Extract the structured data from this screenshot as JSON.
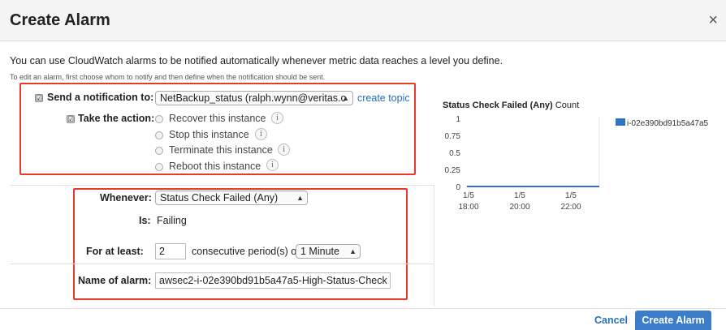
{
  "dialog": {
    "title": "Create Alarm",
    "close": "×",
    "intro": "You can use CloudWatch alarms to be notified automatically whenever metric data reaches a level you define.",
    "hint": "To edit an alarm, first choose whom to notify and then define when the notification should be sent."
  },
  "notify": {
    "checkbox": "☑",
    "label": "Send a notification to:",
    "topic": "NetBackup_status (ralph.wynn@veritas.c",
    "create_topic": "create topic"
  },
  "action": {
    "checkbox": "☑",
    "label": "Take the action:",
    "options": [
      {
        "label": "Recover this instance"
      },
      {
        "label": "Stop this instance"
      },
      {
        "label": "Terminate this instance"
      },
      {
        "label": "Reboot this instance"
      }
    ]
  },
  "condition": {
    "whenever_label": "Whenever:",
    "whenever_value": "Status Check Failed (Any)",
    "is_label": "Is:",
    "is_value": "Failing",
    "for_label": "For at least:",
    "periods": "2",
    "periods_text": "consecutive period(s) of",
    "period_value": "1 Minute",
    "name_label": "Name of alarm:",
    "name_value": "awsec2-i-02e390bd91b5a47a5-High-Status-Check"
  },
  "chart_data": {
    "type": "line",
    "title": "Status Check Failed (Any)",
    "subtitle": "Count",
    "yticks": [
      "1",
      "0.75",
      "0.5",
      "0.25",
      "0"
    ],
    "ylim": [
      0,
      1
    ],
    "xticks": [
      {
        "date": "1/5",
        "time": "18:00"
      },
      {
        "date": "1/5",
        "time": "20:00"
      },
      {
        "date": "1/5",
        "time": "22:00"
      }
    ],
    "series": [
      {
        "name": "i-02e390bd91b5a47a5",
        "color": "#2e73c4",
        "values": [
          0,
          0,
          0
        ]
      }
    ]
  },
  "footer": {
    "cancel": "Cancel",
    "create": "Create Alarm"
  },
  "colors": {
    "accent": "#3b7dc8",
    "highlight_box": "#e53b2c",
    "link": "#2471b8"
  }
}
